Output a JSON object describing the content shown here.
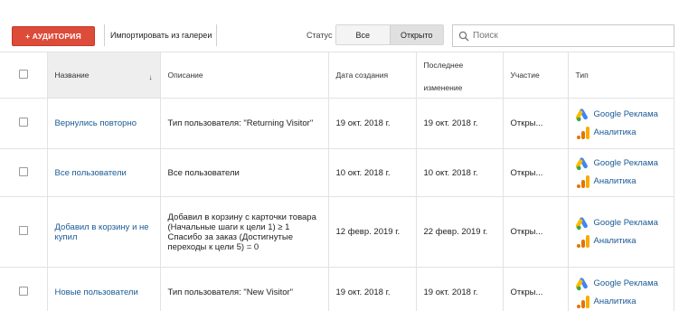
{
  "toolbar": {
    "add_label": "+ АУДИТОРИЯ",
    "import_label": "Импортировать из галереи",
    "status_label": "Статус",
    "status_options": [
      "Все",
      "Открыто"
    ],
    "search_placeholder": "Поиск"
  },
  "table": {
    "headers": {
      "name": "Название",
      "description": "Описание",
      "created": "Дата создания",
      "modified_line1": "Последнее",
      "modified_line2": "изменение",
      "participation": "Участие",
      "type": "Тип"
    },
    "type_labels": {
      "ads": "Google Реклама",
      "analytics": "Аналитика"
    },
    "rows": [
      {
        "name": "Вернулись повторно",
        "description": "Тип пользователя: \"Returning Visitor\"",
        "created": "19 окт. 2018 г.",
        "modified": "19 окт. 2018 г.",
        "participation": "Откры..."
      },
      {
        "name": "Все пользователи",
        "description": "Все пользователи",
        "created": "10 окт. 2018 г.",
        "modified": "10 окт. 2018 г.",
        "participation": "Откры..."
      },
      {
        "name": "Добавил в корзину и не купил",
        "description": "Добавил в корзину с карточки товара (Начальные шаги к цели 1) ≥ 1 Спасибо за заказ (Достигнутые переходы к цели 5) = 0",
        "created": "12 февр. 2019 г.",
        "modified": "22 февр. 2019 г.",
        "participation": "Откры..."
      },
      {
        "name": "Новые пользователи",
        "description": "Тип пользователя: \"New Visitor\"",
        "created": "19 окт. 2018 г.",
        "modified": "19 окт. 2018 г.",
        "participation": "Откры..."
      }
    ]
  },
  "colors": {
    "accent_red": "#dd4b39",
    "link_blue": "#1a5a96",
    "ads_blue": "#4285f4",
    "ads_yellow": "#fbbc04",
    "ads_green": "#34a853",
    "analytics_orange": "#f9ab00",
    "analytics_dark": "#e37400"
  },
  "icons": [
    "search-icon",
    "sort-down-icon",
    "google-ads-icon",
    "analytics-icon"
  ]
}
